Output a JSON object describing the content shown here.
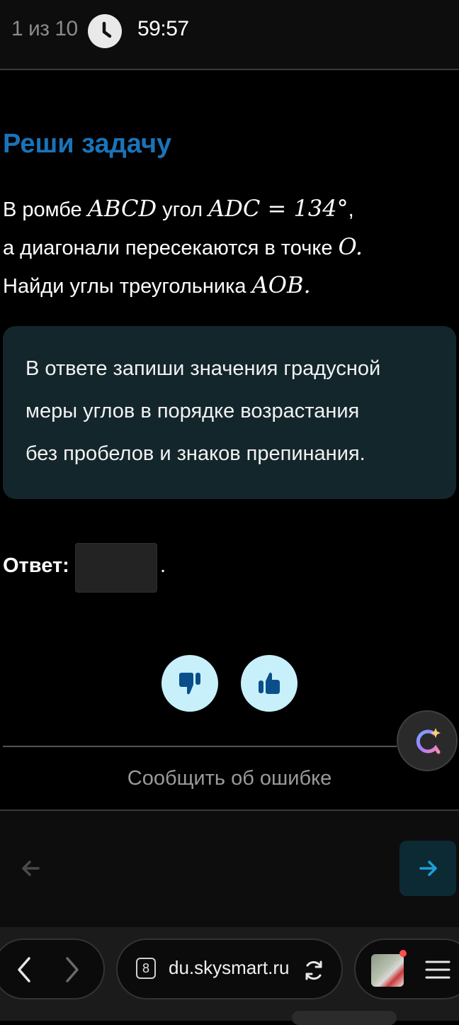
{
  "topbar": {
    "counter": "1 из 10",
    "timer": "59:57"
  },
  "task": {
    "title": "Реши задачу",
    "line1_text": "В ромбе ",
    "line1_math1": "ABCD",
    "line1_text2": " угол ",
    "line1_math2": "ADC",
    "line1_eq": " = ",
    "line1_value": "134",
    "line1_unit": "°",
    "line1_tail": ",",
    "line2_text": "а диагонали пересекаются в точке ",
    "line2_math": "O",
    "line2_tail": ".",
    "line3_text": "Найди углы треугольника ",
    "line3_math": "AOB",
    "line3_tail": "."
  },
  "hint": {
    "line1": "В ответе запиши значения градусной",
    "line2": "меры углов в порядке возрастания",
    "line3": "без пробелов и знаков препинания."
  },
  "answer": {
    "label": "Ответ:",
    "value": "",
    "suffix": "."
  },
  "feedback": {
    "report_label": "Сообщить об ошибке"
  },
  "browser": {
    "tab_count": "8",
    "url": "du.skysmart.ru"
  },
  "colors": {
    "accent": "#1a73b8",
    "hint_bg": "#13262b",
    "vote_bg": "#c8f0fb",
    "next_bg": "#0c2a33"
  },
  "icons": {
    "clock": "clock-icon",
    "dislike": "thumbs-down-icon",
    "like": "thumbs-up-icon",
    "assistant": "ai-assistant-icon",
    "prev": "arrow-left-icon",
    "next": "arrow-right-icon",
    "back": "chevron-left-icon",
    "forward": "chevron-right-icon",
    "reload": "reload-icon",
    "menu": "menu-icon"
  }
}
